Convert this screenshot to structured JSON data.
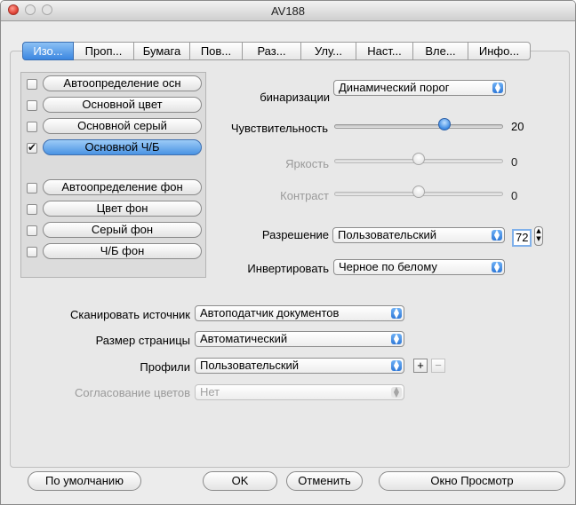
{
  "window": {
    "title": "AV188"
  },
  "tabs": [
    "Изо...",
    "Проп...",
    "Бумага",
    "Пов...",
    "Раз...",
    "Улу...",
    "Наст...",
    "Вле...",
    "Инфо..."
  ],
  "left_panel": {
    "items": [
      {
        "label": "Автоопределение осн",
        "checked": false,
        "active": false
      },
      {
        "label": "Основной цвет",
        "checked": false,
        "active": false
      },
      {
        "label": "Основной серый",
        "checked": false,
        "active": false
      },
      {
        "label": "Основной Ч/Б",
        "checked": true,
        "active": true
      },
      {
        "label": "Автоопределение фон",
        "checked": false,
        "active": false
      },
      {
        "label": "Цвет фон",
        "checked": false,
        "active": false
      },
      {
        "label": "Серый фон",
        "checked": false,
        "active": false
      },
      {
        "label": "Ч/Б фон",
        "checked": false,
        "active": false
      }
    ]
  },
  "settings": {
    "binarization": {
      "label": "бинаризации",
      "value": "Динамический порог"
    },
    "sensitivity": {
      "label": "Чувствительность",
      "value": "20"
    },
    "brightness": {
      "label": "Яркость",
      "value": "0"
    },
    "contrast": {
      "label": "Контраст",
      "value": "0"
    },
    "resolution": {
      "label": "Разрешение",
      "value": "Пользовательский",
      "dpi": "72"
    },
    "invert": {
      "label": "Инвертировать",
      "value": "Черное по белому"
    }
  },
  "bottom": {
    "source": {
      "label": "Сканировать источник",
      "value": "Автоподатчик документов"
    },
    "page_size": {
      "label": "Размер страницы",
      "value": "Автоматический"
    },
    "profiles": {
      "label": "Профили",
      "value": "Пользовательский",
      "add": "+",
      "remove": "−"
    },
    "color_match": {
      "label": "Согласование цветов",
      "value": "Нет"
    }
  },
  "buttons": {
    "default": "По умолчанию",
    "ok": "OK",
    "cancel": "Отменить",
    "preview": "Окно Просмотр"
  },
  "colors": {
    "accent": "#3b86e0",
    "close": "#e2463a"
  },
  "icons": {
    "stepper_up": "▲",
    "stepper_down": "▼",
    "select_arrows": "▲▼"
  }
}
